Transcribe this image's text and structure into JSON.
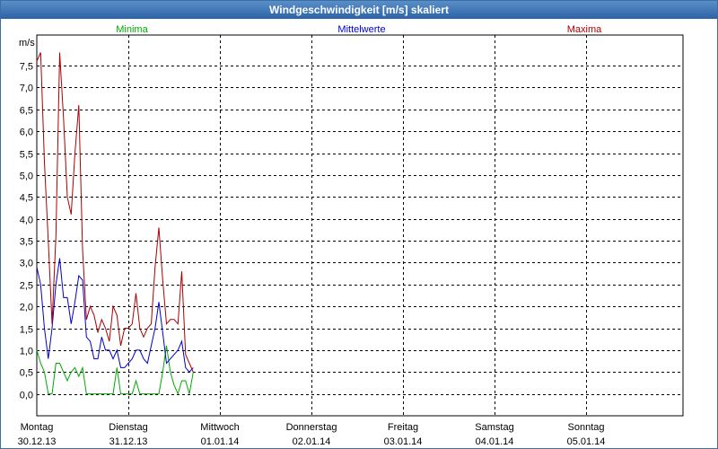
{
  "window": {
    "title": "Windgeschwindigkeit [m/s] skaliert"
  },
  "chart_data": {
    "type": "line",
    "title": "Windgeschwindigkeit [m/s] skaliert",
    "ylabel": "m/s",
    "xlabel": "",
    "ylim": [
      -0.5,
      8.2
    ],
    "grid": true,
    "legend_placement": "top",
    "y_ticks": [
      "0,0",
      "0,5",
      "1,0",
      "1,5",
      "2,0",
      "2,5",
      "3,0",
      "3,5",
      "4,0",
      "4,5",
      "5,0",
      "5,5",
      "6,0",
      "6,5",
      "7,0",
      "7,5"
    ],
    "x_ticks": [
      {
        "day": "Montag",
        "date": "30.12.13"
      },
      {
        "day": "Dienstag",
        "date": "31.12.13"
      },
      {
        "day": "Mittwoch",
        "date": "01.01.14"
      },
      {
        "day": "Donnerstag",
        "date": "02.01.14"
      },
      {
        "day": "Freitag",
        "date": "03.01.14"
      },
      {
        "day": "Samstag",
        "date": "04.01.14"
      },
      {
        "day": "Sonntag",
        "date": "05.01.14"
      }
    ],
    "x_sample_hours": 1.0,
    "series": [
      {
        "name": "Minima",
        "color": "#00aa00",
        "values": [
          1.0,
          0.7,
          0.5,
          0.0,
          0.0,
          0.7,
          0.7,
          0.5,
          0.3,
          0.5,
          0.6,
          0.4,
          0.6,
          0.0,
          0.0,
          0.0,
          0.0,
          0.0,
          0.0,
          0.0,
          0.0,
          0.6,
          0.0,
          0.0,
          0.0,
          0.0,
          0.3,
          0.0,
          0.0,
          0.0,
          0.0,
          0.0,
          0.0,
          0.5,
          1.1,
          0.5,
          0.2,
          0.0,
          0.3,
          0.3,
          0.0,
          0.5
        ]
      },
      {
        "name": "Mittelwerte",
        "color": "#0000cc",
        "values": [
          2.9,
          2.5,
          1.5,
          0.8,
          1.5,
          2.5,
          3.1,
          2.2,
          2.2,
          1.6,
          2.1,
          2.7,
          2.6,
          1.3,
          1.2,
          0.8,
          0.8,
          1.3,
          1.0,
          1.0,
          0.8,
          1.0,
          0.6,
          0.6,
          0.7,
          0.8,
          1.0,
          1.0,
          0.8,
          0.7,
          1.1,
          1.5,
          2.1,
          1.4,
          0.7,
          0.8,
          0.9,
          1.0,
          1.2,
          0.6,
          0.5,
          0.6
        ]
      },
      {
        "name": "Maxima",
        "color": "#aa0000",
        "values": [
          7.6,
          7.8,
          5.3,
          3.5,
          1.6,
          3.6,
          7.8,
          6.3,
          4.5,
          4.1,
          5.5,
          6.6,
          3.3,
          1.7,
          2.0,
          1.8,
          1.4,
          1.7,
          1.5,
          1.2,
          2.0,
          1.8,
          1.1,
          1.5,
          1.5,
          1.6,
          2.3,
          1.5,
          1.3,
          1.5,
          1.6,
          2.9,
          3.8,
          2.6,
          1.6,
          1.7,
          1.7,
          1.6,
          2.8,
          0.9,
          0.7,
          0.5
        ]
      }
    ]
  }
}
